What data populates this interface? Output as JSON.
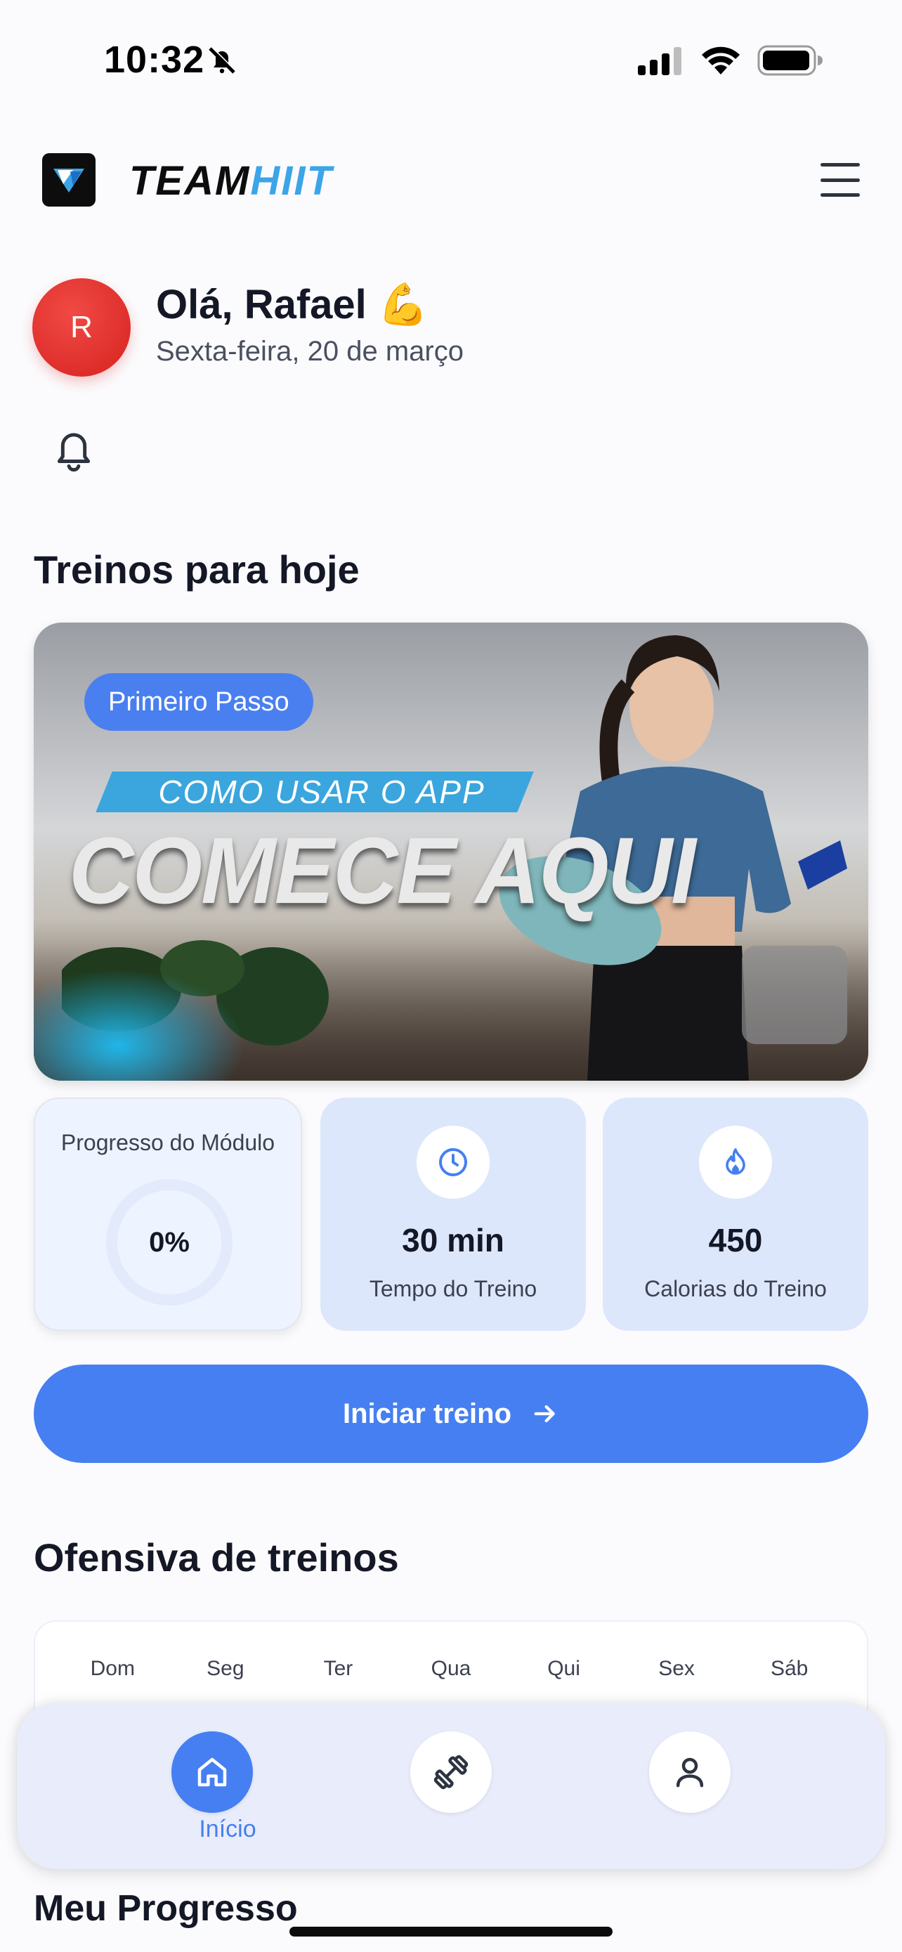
{
  "status_bar": {
    "time": "10:32"
  },
  "header": {
    "logo_text_a": "TEAM",
    "logo_text_b": "HIIT"
  },
  "user": {
    "initial": "R",
    "greeting": "Olá, Rafael 💪",
    "date": "Sexta-feira, 20 de março"
  },
  "sections": {
    "today": "Treinos para hoje",
    "streak": "Ofensiva de treinos",
    "progress": "Meu Progresso"
  },
  "hero": {
    "badge": "Primeiro Passo",
    "ribbon": "COMO USAR O APP",
    "title": "COMECE AQUI"
  },
  "stats": {
    "progress_label": "Progresso do Módulo",
    "progress_value": "0%",
    "time_value": "30 min",
    "time_label": "Tempo do Treino",
    "calories_value": "450",
    "calories_label": "Calorias do Treino"
  },
  "cta": {
    "label": "Iniciar treino"
  },
  "weekdays": [
    "Dom",
    "Seg",
    "Ter",
    "Qua",
    "Qui",
    "Sex",
    "Sáb"
  ],
  "bottom_nav": {
    "home_label": "Início"
  },
  "colors": {
    "accent": "#457ff2",
    "avatar": "#e03432",
    "card_bg": "#dde7fb",
    "logo_accent": "#3ca5e8"
  },
  "icons": [
    "bell-muted-icon",
    "signal-icon",
    "wifi-icon",
    "battery-icon",
    "menu-icon",
    "bell-icon",
    "clock-icon",
    "flame-icon",
    "arrow-right-icon",
    "home-icon",
    "dumbbell-icon",
    "user-icon"
  ]
}
